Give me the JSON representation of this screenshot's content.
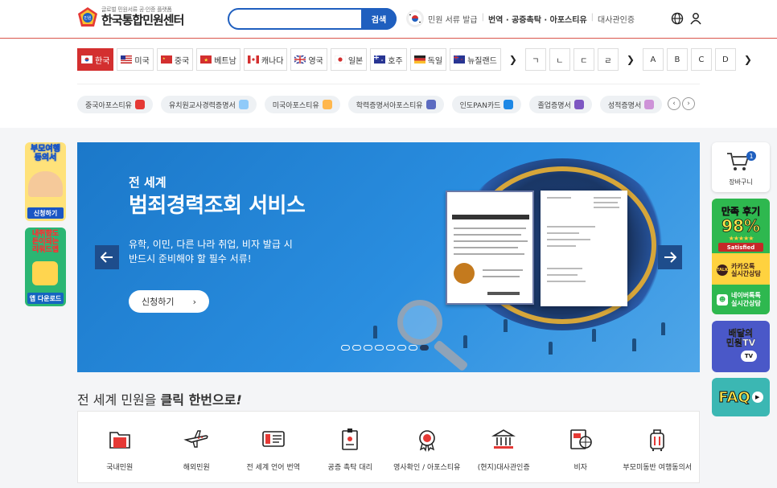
{
  "header": {
    "logo_badge": "민원",
    "logo_sub": "글로벌 민원서류 공·인증 플랫폼",
    "logo_main": "한국통합민원센터",
    "search_placeholder": "",
    "search_button": "검색",
    "links": [
      {
        "label": "민원 서류 발급",
        "bold": false
      },
      {
        "label": "번역 · 공증촉탁 · 아포스티유",
        "bold": true
      },
      {
        "label": "대사관인증",
        "bold": false
      }
    ]
  },
  "countries": [
    {
      "label": "한국",
      "flag": "kr",
      "active": true
    },
    {
      "label": "미국",
      "flag": "us",
      "active": false
    },
    {
      "label": "중국",
      "flag": "cn",
      "active": false
    },
    {
      "label": "베트남",
      "flag": "vn",
      "active": false
    },
    {
      "label": "캐나다",
      "flag": "ca",
      "active": false
    },
    {
      "label": "영국",
      "flag": "gb",
      "active": false
    },
    {
      "label": "일본",
      "flag": "jp",
      "active": false
    },
    {
      "label": "호주",
      "flag": "au",
      "active": false
    },
    {
      "label": "독일",
      "flag": "de",
      "active": false
    },
    {
      "label": "뉴질랜드",
      "flag": "nz",
      "active": false
    }
  ],
  "letters_korean": [
    "ㄱ",
    "ㄴ",
    "ㄷ",
    "ㄹ"
  ],
  "letters_latin": [
    "A",
    "B",
    "C",
    "D"
  ],
  "tags": [
    {
      "label": "중국아포스티유",
      "color": "#e53935"
    },
    {
      "label": "유치원교사경력증명서",
      "color": "#90caf9"
    },
    {
      "label": "미국아포스티유",
      "color": "#ffb74d"
    },
    {
      "label": "학력증명서아포스티유",
      "color": "#5c6bc0"
    },
    {
      "label": "인도PAN카드",
      "color": "#1e88e5"
    },
    {
      "label": "졸업증명서",
      "color": "#7e57c2"
    },
    {
      "label": "성적증명서",
      "color": "#ce93d8"
    }
  ],
  "left_ads": {
    "ad1_title": "부모여행\n동의서",
    "ad1_button": "신청하기",
    "ad2_title": "내취향도\n돈이되는\n리워드앱",
    "ad2_button": "앱 다운로드"
  },
  "banner": {
    "subtitle": "전 세계",
    "title": "범죄경력조회 서비스",
    "description": "유학, 이민, 다른 나라 취업, 비자 발급 시\n반드시 준비해야 할 필수 서류!",
    "cta": "신청하기",
    "slide_count": 8,
    "active_slide": 8
  },
  "sidebar": {
    "cart_label": "장바구니",
    "cart_count": "1",
    "review_title": "만족 후기",
    "review_percent": "98%",
    "review_badge": "Satisfied",
    "kakao_badge": "TALK",
    "kakao_label": "카카오톡\n실시간상담",
    "naver_label": "네이버톡톡\n실시간상담",
    "tv_title": "배달의\n민원TV",
    "tv_badge": "TV",
    "faq_label": "FAQ"
  },
  "section": {
    "title_normal": "전 세계 민원을 ",
    "title_bold": "클릭 한번으로",
    "title_italic": "!"
  },
  "services": [
    {
      "label": "국내민원",
      "icon": "folder-icon"
    },
    {
      "label": "해외민원",
      "icon": "airplane-icon"
    },
    {
      "label": "전 세계 언어 번역",
      "icon": "translate-card-icon"
    },
    {
      "label": "공증 촉탁 대리",
      "icon": "badge-document-icon"
    },
    {
      "label": "영사확인 / 아포스티유",
      "icon": "seal-icon"
    },
    {
      "label": "(현지)대사관인증",
      "icon": "embassy-icon"
    },
    {
      "label": "비자",
      "icon": "visa-icon"
    },
    {
      "label": "부모미동반 여행동의서",
      "icon": "luggage-icon"
    }
  ]
}
